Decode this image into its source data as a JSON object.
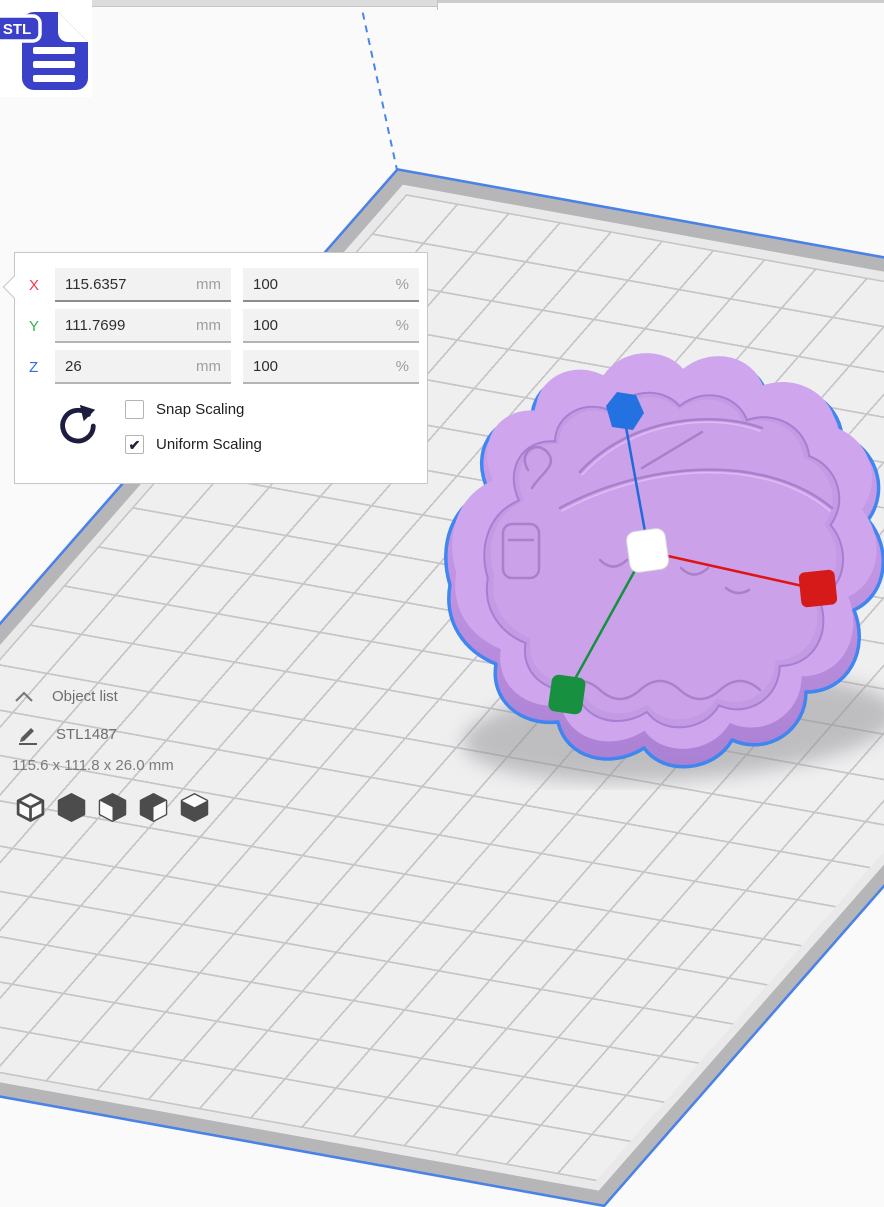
{
  "window": {
    "background": "#fafafa"
  },
  "logo": {
    "badge_text": "STL",
    "color": "#3a40c8"
  },
  "scale_panel": {
    "rows": [
      {
        "axis": "X",
        "value": "115.6357",
        "unit": "mm",
        "percent": "100",
        "percent_unit": "%"
      },
      {
        "axis": "Y",
        "value": "111.7699",
        "unit": "mm",
        "percent": "100",
        "percent_unit": "%"
      },
      {
        "axis": "Z",
        "value": "26",
        "unit": "mm",
        "percent": "100",
        "percent_unit": "%"
      }
    ],
    "snap_label": "Snap Scaling",
    "snap_glyph": "",
    "uniform_label": "Uniform Scaling",
    "uniform_glyph": "✔",
    "axis_colors": {
      "x": "#f43a4d",
      "y": "#35b34f",
      "z": "#2a6fe4"
    }
  },
  "object_panel": {
    "title": "Object list",
    "item_name": "STL1487",
    "dimensions": "115.6 x 111.8 x 26.0 mm"
  },
  "scene": {
    "model_color": "#cfa6ee",
    "model_wall_dark": "#a97fd2",
    "cavity_color": "#cba1ea",
    "engraving_color": "#a77cc9",
    "selection_color": "#3f86f0",
    "plate_grid_color": "#c6c6c8",
    "handles": {
      "x": "#d61a1a",
      "y": "#17913f",
      "z": "#2472e2",
      "center": "#ffffff"
    }
  }
}
